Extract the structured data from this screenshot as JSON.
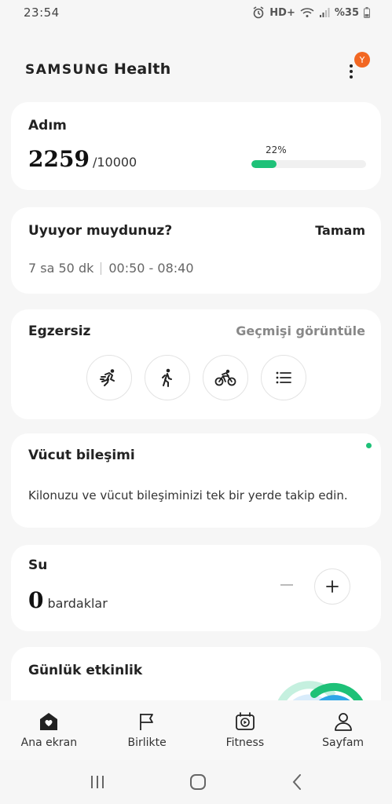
{
  "status_bar": {
    "time": "23:54",
    "network": "HD+",
    "battery": "%35"
  },
  "header": {
    "brand_primary": "SAMSUNG",
    "brand_secondary": "Health",
    "avatar_initial": "Y"
  },
  "steps": {
    "title": "Adım",
    "value": "2259",
    "goal": "/10000",
    "progress_label": "22%",
    "progress_fraction": 0.22
  },
  "sleep": {
    "title": "Uyuyor muydunuz?",
    "action": "Tamam",
    "duration": "7 sa 50 dk",
    "time_range": "00:50 - 08:40"
  },
  "exercise": {
    "title": "Egzersiz",
    "history_link": "Geçmişi görüntüle",
    "icons": [
      "running-icon",
      "walking-icon",
      "cycling-icon",
      "list-icon"
    ]
  },
  "body_composition": {
    "title": "Vücut bileşimi",
    "description": "Kilonuzu ve vücut bileşiminizi tek bir yerde takip edin."
  },
  "water": {
    "title": "Su",
    "value": "0",
    "unit": "bardaklar"
  },
  "daily_activity": {
    "title": "Günlük etkinlik"
  },
  "bottom_nav": [
    {
      "label": "Ana ekran",
      "icon": "home-icon"
    },
    {
      "label": "Birlikte",
      "icon": "flag-icon"
    },
    {
      "label": "Fitness",
      "icon": "fitness-icon"
    },
    {
      "label": "Sayfam",
      "icon": "profile-icon"
    }
  ],
  "colors": {
    "accent_green": "#1ec178",
    "avatar_orange": "#f26722",
    "background": "#f6f6f6"
  }
}
